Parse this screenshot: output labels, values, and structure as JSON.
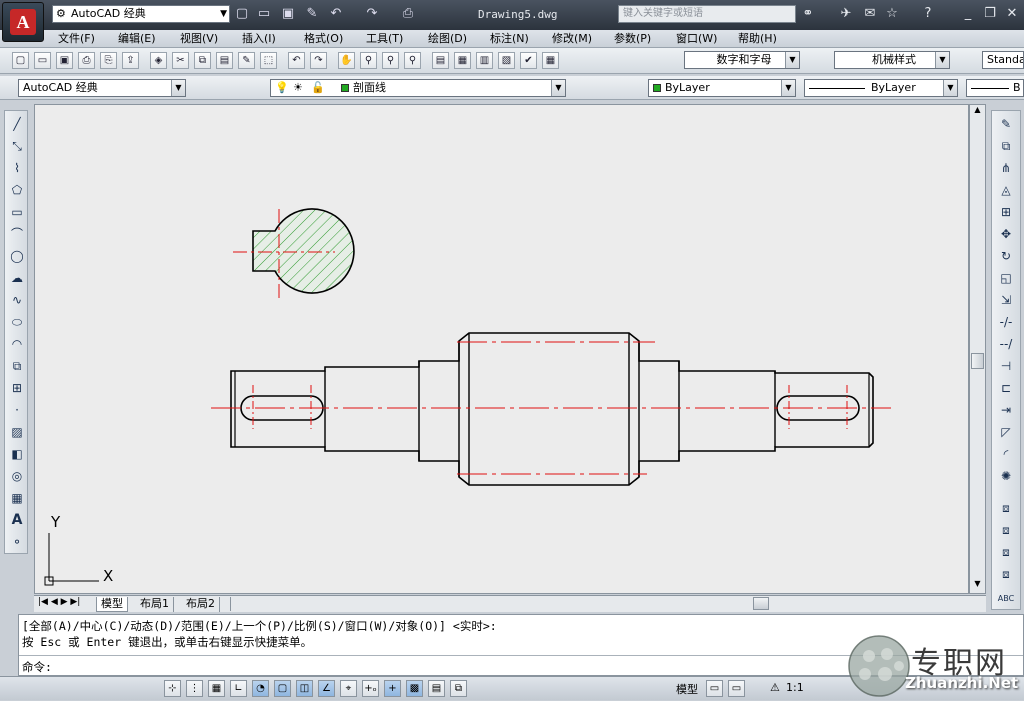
{
  "app": {
    "title": "AutoCAD 经典",
    "doc_title": "Drawing5.dwg",
    "search_placeholder": "键入关键字或短语"
  },
  "menu": [
    {
      "label": "文件(F)"
    },
    {
      "label": "编辑(E)"
    },
    {
      "label": "视图(V)"
    },
    {
      "label": "插入(I)"
    },
    {
      "label": "格式(O)"
    },
    {
      "label": "工具(T)"
    },
    {
      "label": "绘图(D)"
    },
    {
      "label": "标注(N)"
    },
    {
      "label": "修改(M)"
    },
    {
      "label": "参数(P)"
    },
    {
      "label": "窗口(W)"
    },
    {
      "label": "帮助(H)"
    }
  ],
  "toolbar": {
    "text_style": "数字和字母",
    "dim_style": "机械样式",
    "table_style": "Standa"
  },
  "layers": {
    "workspace": "AutoCAD 经典",
    "current_layer": "剖面线",
    "color": "ByLayer",
    "linetype": "ByLayer",
    "lineweight": "B"
  },
  "colors": {
    "accent": "#c62828",
    "layer_swatch": "#22aa22",
    "centerline": "#e01010",
    "hatch": "#2e9a2e"
  },
  "ucs": {
    "x": "X",
    "y": "Y"
  },
  "tabs": [
    {
      "label": "模型",
      "active": true
    },
    {
      "label": "布局1"
    },
    {
      "label": "布局2"
    }
  ],
  "command": {
    "line1": "[全部(A)/中心(C)/动态(D)/范围(E)/上一个(P)/比例(S)/窗口(W)/对象(O)] <实时>:",
    "line2": "按 Esc 或 Enter 键退出，或单击右键显示快捷菜单。",
    "prompt": "命令:"
  },
  "status": {
    "model": "模型",
    "scale": "1:1"
  },
  "watermark": {
    "cn": "专职网",
    "en": "Zhuanzhi.Net"
  }
}
